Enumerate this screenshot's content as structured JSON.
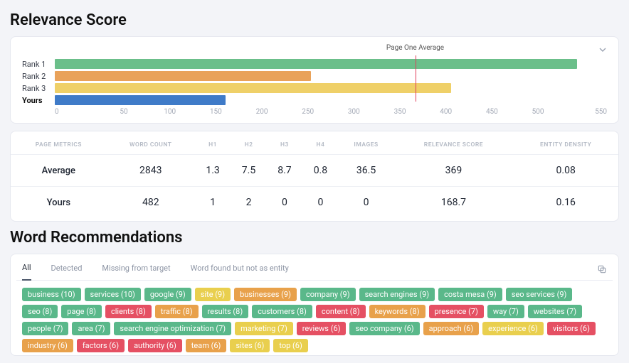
{
  "section_relevance_title": "Relevance Score",
  "section_words_title": "Word Recommendations",
  "chart_data": {
    "type": "bar",
    "orientation": "horizontal",
    "categories": [
      "Rank 1",
      "Rank 2",
      "Rank 3",
      "Yours"
    ],
    "values": [
      520,
      255,
      395,
      170
    ],
    "xlim": [
      0,
      550
    ],
    "xticks": [
      0,
      50,
      100,
      150,
      200,
      250,
      300,
      350,
      400,
      450,
      500,
      550
    ],
    "marker": {
      "label": "Page One Average",
      "value": 359
    },
    "bar_colors": [
      "#6bbf8a",
      "#e9a25a",
      "#efd068",
      "#3f7bc8"
    ]
  },
  "metrics_headers": [
    "PAGE METRICS",
    "WORD COUNT",
    "H1",
    "H2",
    "H3",
    "H4",
    "IMAGES",
    "RELEVANCE SCORE",
    "ENTITY DENSITY"
  ],
  "metrics_rows": [
    {
      "label": "Average",
      "cells": [
        "2843",
        "1.3",
        "7.5",
        "8.7",
        "0.8",
        "36.5",
        "369",
        "0.08"
      ]
    },
    {
      "label": "Yours",
      "cells": [
        "482",
        "1",
        "2",
        "0",
        "0",
        "0",
        "168.7",
        "0.16"
      ]
    }
  ],
  "tabs": [
    "All",
    "Detected",
    "Missing from target",
    "Word found but not as entity"
  ],
  "tags": [
    {
      "t": "business (10)",
      "c": "green"
    },
    {
      "t": "services (10)",
      "c": "green"
    },
    {
      "t": "google (9)",
      "c": "green"
    },
    {
      "t": "site (9)",
      "c": "yellow"
    },
    {
      "t": "businesses (9)",
      "c": "orange"
    },
    {
      "t": "company (9)",
      "c": "green"
    },
    {
      "t": "search engines (9)",
      "c": "green"
    },
    {
      "t": "costa mesa (9)",
      "c": "green"
    },
    {
      "t": "seo services (9)",
      "c": "green"
    },
    {
      "t": "seo (8)",
      "c": "green"
    },
    {
      "t": "page (8)",
      "c": "green"
    },
    {
      "t": "clients (8)",
      "c": "red"
    },
    {
      "t": "traffic (8)",
      "c": "orange"
    },
    {
      "t": "results (8)",
      "c": "green"
    },
    {
      "t": "customers (8)",
      "c": "green"
    },
    {
      "t": "content (8)",
      "c": "red"
    },
    {
      "t": "keywords (8)",
      "c": "orange"
    },
    {
      "t": "presence (7)",
      "c": "red"
    },
    {
      "t": "way (7)",
      "c": "green"
    },
    {
      "t": "websites (7)",
      "c": "green"
    },
    {
      "t": "people (7)",
      "c": "green"
    },
    {
      "t": "area (7)",
      "c": "green"
    },
    {
      "t": "search engine optimization (7)",
      "c": "green"
    },
    {
      "t": "marketing (7)",
      "c": "yellow"
    },
    {
      "t": "reviews (6)",
      "c": "red"
    },
    {
      "t": "seo company (6)",
      "c": "green"
    },
    {
      "t": "approach (6)",
      "c": "orange"
    },
    {
      "t": "experience (6)",
      "c": "yellow"
    },
    {
      "t": "visitors (6)",
      "c": "red"
    },
    {
      "t": "industry (6)",
      "c": "orange"
    },
    {
      "t": "factors (6)",
      "c": "red"
    },
    {
      "t": "authority (6)",
      "c": "red"
    },
    {
      "t": "team (6)",
      "c": "orange"
    },
    {
      "t": "sites (6)",
      "c": "yellow"
    },
    {
      "t": "top (6)",
      "c": "yellow"
    }
  ]
}
